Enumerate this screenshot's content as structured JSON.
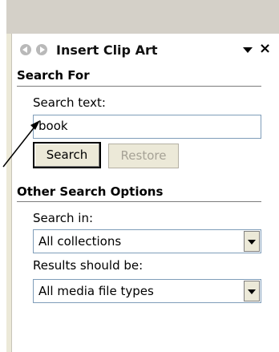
{
  "pane": {
    "title": "Insert Clip Art",
    "nav_back_icon": "back-arrow-icon",
    "nav_forward_icon": "forward-arrow-icon",
    "menu_icon": "chevron-down-icon",
    "close_label": "×"
  },
  "search_for": {
    "heading": "Search For",
    "search_text_label": "Search text:",
    "search_text_value": "book",
    "search_button": "Search",
    "restore_button": "Restore"
  },
  "other_options": {
    "heading": "Other Search Options",
    "search_in_label": "Search in:",
    "search_in_value": "All collections",
    "results_label": "Results should be:",
    "results_value": "All media file types"
  },
  "colors": {
    "field_border": "#7f9db9",
    "button_face": "#ece9d8",
    "disabled_text": "#a6a296"
  }
}
